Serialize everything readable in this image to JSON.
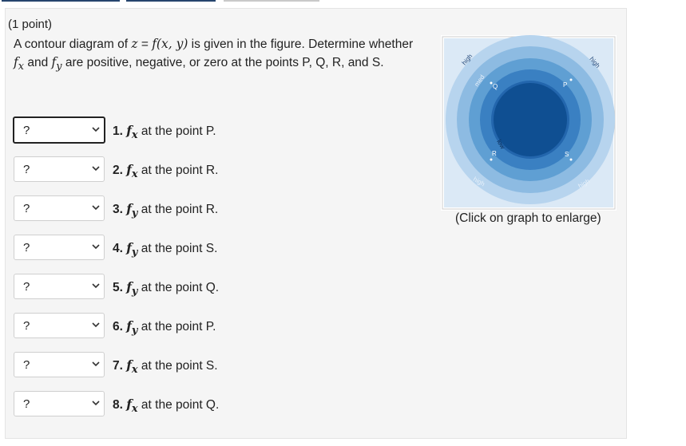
{
  "header": {
    "tabs": [
      "",
      "",
      ""
    ]
  },
  "problem": {
    "points": "(1 point)",
    "intro_a": "A contour diagram of ",
    "intro_z": "z",
    "intro_eq": " = ",
    "intro_f": "f(x, y)",
    "intro_b": " is given in the figure. Determine whether ",
    "fx": "f",
    "fx_sub": "x",
    "intro_and": " and ",
    "fy": "f",
    "fy_sub": "y",
    "intro_c": " are positive, negative, or zero at the points P, Q, R, and S."
  },
  "questions": [
    {
      "num": "1.",
      "fn": "f",
      "sub": "x",
      "text": " at the point P.",
      "value": "?"
    },
    {
      "num": "2.",
      "fn": "f",
      "sub": "x",
      "text": " at the point R.",
      "value": "?"
    },
    {
      "num": "3.",
      "fn": "f",
      "sub": "y",
      "text": " at the point R.",
      "value": "?"
    },
    {
      "num": "4.",
      "fn": "f",
      "sub": "y",
      "text": " at the point S.",
      "value": "?"
    },
    {
      "num": "5.",
      "fn": "f",
      "sub": "y",
      "text": " at the point Q.",
      "value": "?"
    },
    {
      "num": "6.",
      "fn": "f",
      "sub": "y",
      "text": " at the point P.",
      "value": "?"
    },
    {
      "num": "7.",
      "fn": "f",
      "sub": "x",
      "text": " at the point S.",
      "value": "?"
    },
    {
      "num": "8.",
      "fn": "f",
      "sub": "x",
      "text": " at the point Q.",
      "value": "?"
    }
  ],
  "figure": {
    "labels": {
      "high": "high",
      "med": "med",
      "low": "low"
    },
    "points": {
      "P": "P",
      "Q": "Q",
      "R": "R",
      "S": "S"
    },
    "caption": "(Click on graph to enlarge)",
    "colors": [
      "#dbe9f6",
      "#b7d4ee",
      "#8dbbe2",
      "#5f9fd3",
      "#3a80c2",
      "#2366ad",
      "#0f4f92"
    ]
  }
}
